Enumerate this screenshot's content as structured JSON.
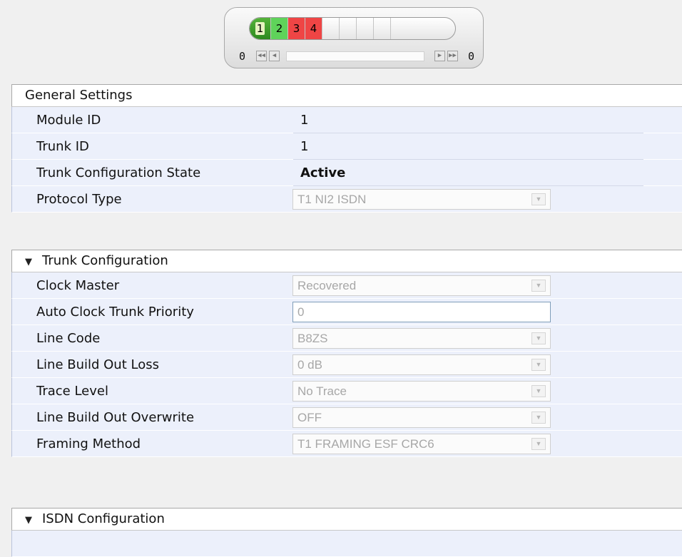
{
  "trunk_selector": {
    "cells": [
      {
        "label": "1",
        "state": "active"
      },
      {
        "label": "2",
        "state": "green"
      },
      {
        "label": "3",
        "state": "red"
      },
      {
        "label": "4",
        "state": "red"
      }
    ],
    "left_count": "0",
    "right_count": "0"
  },
  "general": {
    "title": "General Settings",
    "rows": [
      {
        "label": "Module ID",
        "value": "1"
      },
      {
        "label": "Trunk ID",
        "value": "1"
      },
      {
        "label": "Trunk Configuration State",
        "value": "Active"
      },
      {
        "label": "Protocol Type",
        "value": "T1 NI2 ISDN"
      }
    ]
  },
  "trunk_config": {
    "title": "Trunk Configuration",
    "rows": [
      {
        "label": "Clock Master",
        "value": "Recovered"
      },
      {
        "label": "Auto Clock Trunk Priority",
        "value": "0"
      },
      {
        "label": "Line Code",
        "value": "B8ZS"
      },
      {
        "label": "Line Build Out Loss",
        "value": "0 dB"
      },
      {
        "label": "Trace Level",
        "value": "No Trace"
      },
      {
        "label": "Line Build Out Overwrite",
        "value": "OFF"
      },
      {
        "label": "Framing Method",
        "value": "T1 FRAMING ESF CRC6"
      }
    ]
  },
  "isdn_config": {
    "title": "ISDN Configuration"
  },
  "colors": {
    "active": "#2e8a1f",
    "green": "#5fd35a",
    "red": "#ef4545",
    "row_bg": "#ecf0fb"
  },
  "icons": {
    "collapse": "triangle-down-icon",
    "dropdown": "chevron-down-icon",
    "nav_first": "first-page-icon",
    "nav_prev": "prev-page-icon",
    "nav_next": "next-page-icon",
    "nav_last": "last-page-icon"
  }
}
